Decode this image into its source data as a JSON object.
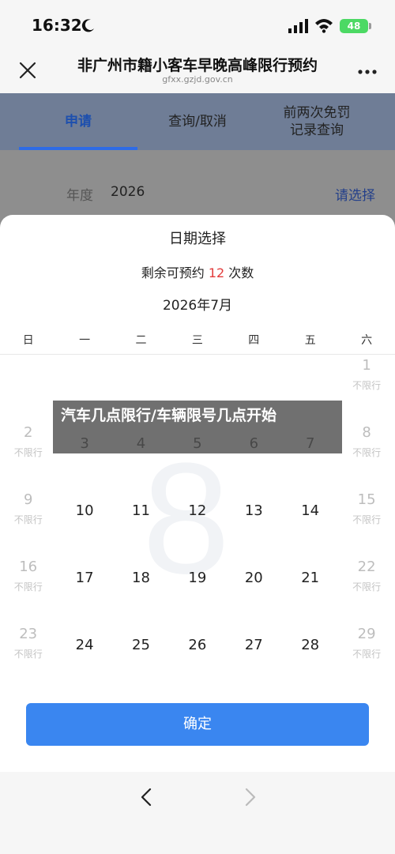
{
  "status_bar": {
    "time": "16:32",
    "battery": "48"
  },
  "header": {
    "title": "非广州市籍小客车早晚高峰限行预约",
    "url": "gfxx.gzjd.gov.cn"
  },
  "tabs": [
    {
      "label": "申请",
      "active": true
    },
    {
      "label": "查询/取消",
      "active": false
    },
    {
      "label": "前两次免罚\n记录查询",
      "active": false
    }
  ],
  "year_row": {
    "label": "年度",
    "value": "2026",
    "action": "请选择"
  },
  "sheet": {
    "title": "日期选择",
    "remaining_prefix": "剩余可预约",
    "remaining_count": "12",
    "remaining_suffix": "次数",
    "month": "2026年7月",
    "weekdays": [
      "日",
      "一",
      "二",
      "三",
      "四",
      "五",
      "六"
    ],
    "watermark": "8",
    "days": [
      {
        "num": "1",
        "note": "不限行",
        "disabled": true,
        "col": 6,
        "row": 0
      },
      {
        "num": "2",
        "note": "不限行",
        "disabled": true,
        "col": 0,
        "row": 1
      },
      {
        "num": "3",
        "note": "",
        "disabled": false,
        "col": 1,
        "row": 1
      },
      {
        "num": "4",
        "note": "",
        "disabled": false,
        "col": 2,
        "row": 1
      },
      {
        "num": "5",
        "note": "",
        "disabled": false,
        "col": 3,
        "row": 1
      },
      {
        "num": "6",
        "note": "",
        "disabled": false,
        "col": 4,
        "row": 1
      },
      {
        "num": "7",
        "note": "",
        "disabled": false,
        "col": 5,
        "row": 1
      },
      {
        "num": "8",
        "note": "不限行",
        "disabled": true,
        "col": 6,
        "row": 1
      },
      {
        "num": "9",
        "note": "不限行",
        "disabled": true,
        "col": 0,
        "row": 2
      },
      {
        "num": "10",
        "note": "",
        "disabled": false,
        "col": 1,
        "row": 2
      },
      {
        "num": "11",
        "note": "",
        "disabled": false,
        "col": 2,
        "row": 2
      },
      {
        "num": "12",
        "note": "",
        "disabled": false,
        "col": 3,
        "row": 2
      },
      {
        "num": "13",
        "note": "",
        "disabled": false,
        "col": 4,
        "row": 2
      },
      {
        "num": "14",
        "note": "",
        "disabled": false,
        "col": 5,
        "row": 2
      },
      {
        "num": "15",
        "note": "不限行",
        "disabled": true,
        "col": 6,
        "row": 2
      },
      {
        "num": "16",
        "note": "不限行",
        "disabled": true,
        "col": 0,
        "row": 3
      },
      {
        "num": "17",
        "note": "",
        "disabled": false,
        "col": 1,
        "row": 3
      },
      {
        "num": "18",
        "note": "",
        "disabled": false,
        "col": 2,
        "row": 3
      },
      {
        "num": "19",
        "note": "",
        "disabled": false,
        "col": 3,
        "row": 3
      },
      {
        "num": "20",
        "note": "",
        "disabled": false,
        "col": 4,
        "row": 3
      },
      {
        "num": "21",
        "note": "",
        "disabled": false,
        "col": 5,
        "row": 3
      },
      {
        "num": "22",
        "note": "不限行",
        "disabled": true,
        "col": 6,
        "row": 3
      },
      {
        "num": "23",
        "note": "不限行",
        "disabled": true,
        "col": 0,
        "row": 4
      },
      {
        "num": "24",
        "note": "",
        "disabled": false,
        "col": 1,
        "row": 4
      },
      {
        "num": "25",
        "note": "",
        "disabled": false,
        "col": 2,
        "row": 4
      },
      {
        "num": "26",
        "note": "",
        "disabled": false,
        "col": 3,
        "row": 4
      },
      {
        "num": "27",
        "note": "",
        "disabled": false,
        "col": 4,
        "row": 4
      },
      {
        "num": "28",
        "note": "",
        "disabled": false,
        "col": 5,
        "row": 4
      },
      {
        "num": "29",
        "note": "不限行",
        "disabled": true,
        "col": 6,
        "row": 4
      }
    ],
    "confirm_label": "确定"
  },
  "overlay": {
    "text": "汽车几点限行/车辆限号几点开始"
  },
  "colors": {
    "primary": "#3a86f0",
    "tab_active": "#1d4fae",
    "count": "#e23b3b"
  }
}
